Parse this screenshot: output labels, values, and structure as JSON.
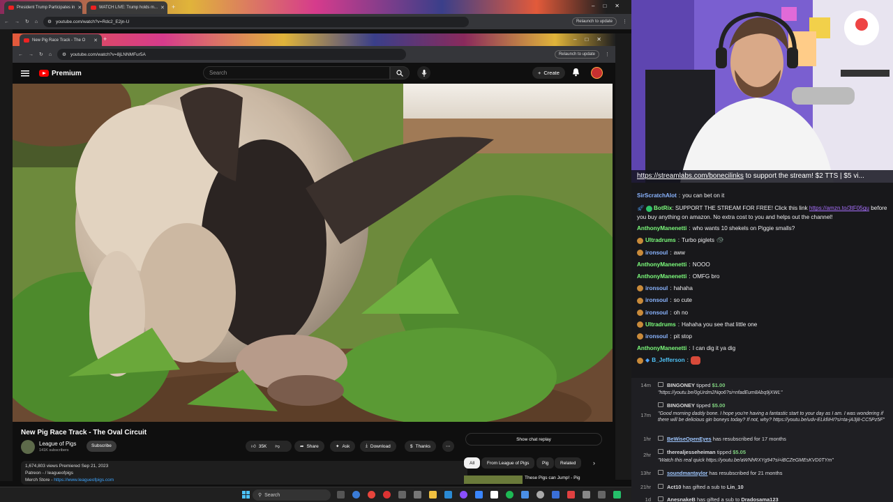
{
  "outer_browser": {
    "tabs": [
      "President Trump Participates in",
      "WATCH LIVE: Trump holds m..."
    ],
    "url": "youtube.com/watch?v=Rdc2_E2jn-U",
    "relaunch": "Relaunch to update"
  },
  "inner_browser": {
    "tab": "New Pig Race Track - The O",
    "url": "youtube.com/watch?v=8jLNNMFur5A",
    "relaunch": "Relaunch to update"
  },
  "youtube": {
    "logo": "Premium",
    "search_placeholder": "Search",
    "create": "Create",
    "video_title": "New Pig Race Track - The Oval Circuit",
    "channel": "League of Pigs",
    "subs": "141K subscribers",
    "subscribe": "Subscribe",
    "likes": "35K",
    "share": "Share",
    "ask": "Ask",
    "download": "Download",
    "thanks": "Thanks",
    "desc_line1": "1,674,803 views  Premiered Sep 21, 2023",
    "desc_line2": "Patreon -  / leagueofpigs",
    "desc_line3_label": "Merch Store - ",
    "desc_line3_link": "https://www.leagueofpigs.com",
    "show_chat": "Show chat replay",
    "chips": [
      "All",
      "From League of Pigs",
      "Pig",
      "Related"
    ],
    "rec_title": "These Pigs can Jump! - Pig"
  },
  "taskbar": {
    "search": "Search"
  },
  "ticker": {
    "link": "https://streamlabs.com/bonecilinks",
    "text": " to support the stream! $2 TTS | $5 vi..."
  },
  "chat": [
    {
      "user": "SirScratchAlot",
      "color": "#8ab4ff",
      "text": "you can bet on it",
      "badge": false
    },
    {
      "user": "BotRix",
      "color": "#7cfc7c",
      "text": "SUPPORT THE STREAM FOR FREE! Click this link ",
      "link": "https://amzn.to/3tF05gu",
      "text2": "before you buy anything on amazon. No extra cost to you and helps out the channel!",
      "badge": true
    },
    {
      "user": "AnthonyManenetti",
      "color": "#7cfc7c",
      "text": "who wants 10 shekels on Piggie smalls?",
      "badge": false
    },
    {
      "user": "Ultradrums",
      "color": "#7cfc7c",
      "text": "Turbo piglets",
      "badge": true
    },
    {
      "user": "ironsoul",
      "color": "#8ab4ff",
      "text": "aww",
      "badge": true
    },
    {
      "user": "AnthonyManenetti",
      "color": "#7cfc7c",
      "text": "NOOO",
      "badge": false
    },
    {
      "user": "AnthonyManenetti",
      "color": "#7cfc7c",
      "text": "OMFG bro",
      "badge": false
    },
    {
      "user": "ironsoul",
      "color": "#8ab4ff",
      "text": "hahaha",
      "badge": true
    },
    {
      "user": "ironsoul",
      "color": "#8ab4ff",
      "text": "so cute",
      "badge": true
    },
    {
      "user": "ironsoul",
      "color": "#8ab4ff",
      "text": "oh no",
      "badge": true
    },
    {
      "user": "Ultradrums",
      "color": "#7cfc7c",
      "text": "Hahaha you see that little one",
      "badge": true
    },
    {
      "user": "ironsoul",
      "color": "#8ab4ff",
      "text": "pit stop",
      "badge": true
    },
    {
      "user": "AnthonyManenetti",
      "color": "#7cfc7c",
      "text": "I can dig it ya dig",
      "badge": false
    },
    {
      "user": "B_Jefferson",
      "color": "#4fc3f7",
      "text": "",
      "badge": true
    }
  ],
  "events": [
    {
      "time": "14m",
      "user": "BINGONEY",
      "action": " tipped ",
      "amount": "$1.00",
      "quote": "\"https://youtu.be/0gUrdm2Nqo6?si=nfadEum8Abq9jXWL\""
    },
    {
      "time": "17m",
      "user": "BINGONEY",
      "action": " tipped ",
      "amount": "$5.00",
      "quote": "\"Good morning daddy bone. I hope you're having a fantastic start to your day as I am. I was wondering if there will be delicious gin boneys today? If not, why? https://youtu.be/udv-ELkfiIHI?si=ta-jA3j8-CC5Pz5F\""
    },
    {
      "time": "1hr",
      "user": "BeWiseOpenEyes",
      "action": " has resubscribed for 17 months",
      "amount": "",
      "quote": ""
    },
    {
      "time": "2hr",
      "user": "therealjesseheiman",
      "action": " tipped ",
      "amount": "$5.05",
      "quote": "\"Watch this real quick https://youtu.be/aWNhRXYg94?si=iBCZeGMEsKVD0TYm\""
    },
    {
      "time": "13hr",
      "user": "soundmantaylor",
      "action": " has resubscribed for 21 months",
      "amount": "",
      "quote": ""
    },
    {
      "time": "21hr",
      "user": "Act10",
      "action": " has gifted a sub to ",
      "amount": "Lin_10",
      "quote": ""
    },
    {
      "time": "1d",
      "user": "AnesnakeB",
      "action": " has gifted a sub to ",
      "amount": "Dradosama123",
      "quote": ""
    }
  ]
}
